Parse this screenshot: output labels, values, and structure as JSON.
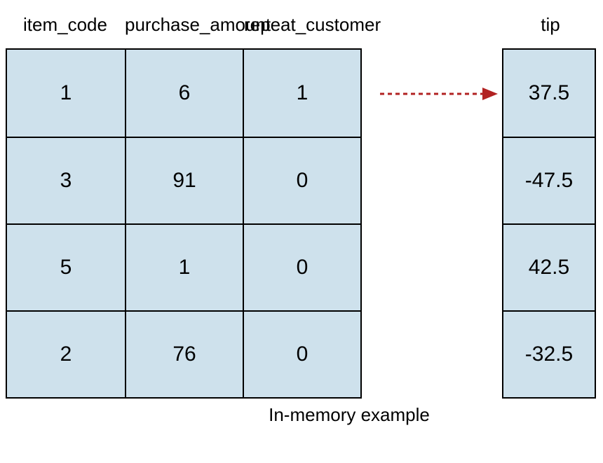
{
  "headers": {
    "col1": "item_code",
    "col2": "purchase_amount",
    "col3": "repeat_customer",
    "col4": "tip"
  },
  "table": {
    "rows": [
      {
        "item_code": "1",
        "purchase_amount": "6",
        "repeat_customer": "1",
        "tip": "37.5"
      },
      {
        "item_code": "3",
        "purchase_amount": "91",
        "repeat_customer": "0",
        "tip": "-47.5"
      },
      {
        "item_code": "5",
        "purchase_amount": "1",
        "repeat_customer": "0",
        "tip": "42.5"
      },
      {
        "item_code": "2",
        "purchase_amount": "76",
        "repeat_customer": "0",
        "tip": "-32.5"
      }
    ]
  },
  "footer": "In-memory example",
  "chart_data": {
    "type": "table",
    "title": "In-memory example",
    "columns": [
      "item_code",
      "purchase_amount",
      "repeat_customer",
      "tip"
    ],
    "rows": [
      [
        1,
        6,
        1,
        37.5
      ],
      [
        3,
        91,
        0,
        -47.5
      ],
      [
        5,
        1,
        0,
        42.5
      ],
      [
        2,
        76,
        0,
        -32.5
      ]
    ],
    "note": "dashed red arrow maps first feature row to first tip value"
  }
}
